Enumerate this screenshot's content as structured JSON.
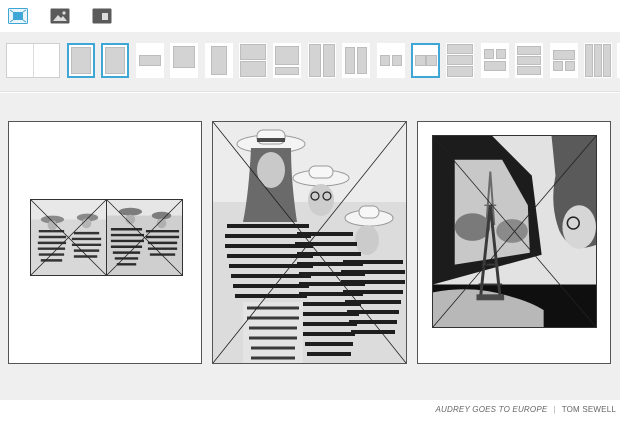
{
  "toolbar": {
    "tools": [
      {
        "name": "fit-photo-tool",
        "icon": "fit-to-frame-icon",
        "active": true
      },
      {
        "name": "add-photo-tool",
        "icon": "image-icon",
        "active": false
      },
      {
        "name": "page-layout-tool",
        "icon": "page-icon",
        "active": false
      }
    ],
    "accent": "#3fa7d6"
  },
  "layouts": {
    "count": 17,
    "selected_indices": [
      1,
      2,
      11
    ]
  },
  "pages": [
    {
      "name": "left-page",
      "photos": 2
    },
    {
      "name": "center-page",
      "photos": 1
    },
    {
      "name": "right-page",
      "photos": 1
    }
  ],
  "footer": {
    "book_title": "AUDREY GOES TO EUROPE",
    "separator": "|",
    "author": "TOM SEWELL"
  }
}
